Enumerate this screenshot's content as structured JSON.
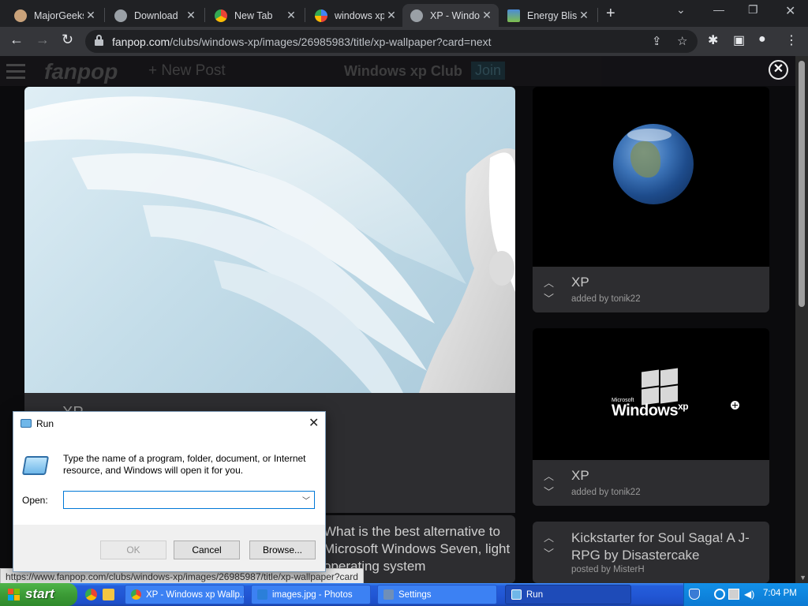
{
  "browser": {
    "tabs": [
      {
        "label": "MajorGeeks",
        "active": false
      },
      {
        "label": "Download",
        "active": false
      },
      {
        "label": "New Tab",
        "active": false
      },
      {
        "label": "windows xp",
        "active": false
      },
      {
        "label": "XP - Windo",
        "active": true
      },
      {
        "label": "Energy Blis",
        "active": false
      }
    ],
    "url_domain": "fanpop.com",
    "url_path": "/clubs/windows-xp/images/26985983/title/xp-wallpaper?card=next"
  },
  "fanpop": {
    "logo": "fanpop",
    "new_post": "+ New Post",
    "club_name": "Windows xp Club",
    "join": "Join",
    "main_title": "XP",
    "side_cards": [
      {
        "title": "XP",
        "subtitle": "added by tonik22"
      },
      {
        "title": "XP",
        "subtitle": "added by tonik22"
      }
    ],
    "lower_text": "What is the best alternative to Microsoft Windows Seven, light operating system",
    "kickstarter": {
      "title": "Kickstarter for Soul Saga! A J-RPG by Disastercake",
      "subtitle": "posted by MisterH"
    },
    "windows_logo_ms": "Microsoft",
    "windows_logo_text": "Windows",
    "windows_logo_sup": "xp"
  },
  "status_url": "https://www.fanpop.com/clubs/windows-xp/images/26985987/title/xp-wallpaper?card",
  "run_dialog": {
    "title": "Run",
    "description": "Type the name of a program, folder, document, or Internet resource, and Windows will open it for you.",
    "open_label": "Open:",
    "open_value": "",
    "ok": "OK",
    "cancel": "Cancel",
    "browse": "Browse..."
  },
  "taskbar": {
    "start": "start",
    "tasks": [
      {
        "label": "XP - Windows xp Wallp...",
        "active": false
      },
      {
        "label": "images.jpg - Photos",
        "active": false
      },
      {
        "label": "Settings",
        "active": false
      },
      {
        "label": "Run",
        "active": true
      }
    ],
    "clock": "7:04 PM"
  }
}
